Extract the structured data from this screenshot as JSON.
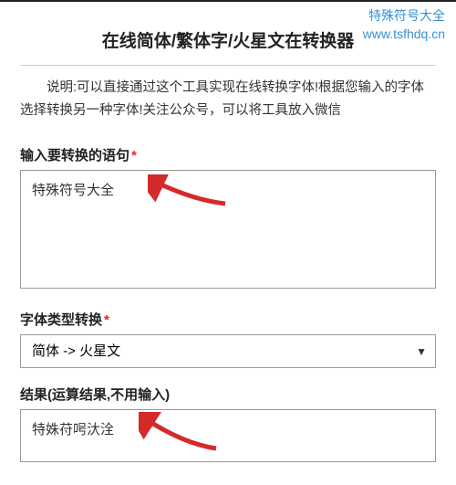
{
  "watermark": {
    "line1": "特殊符号大全",
    "line2": "www.tsfhdq.cn"
  },
  "title": "在线简体/繁体字/火星文在转换器",
  "description": "说明:可以直接通过这个工具实现在线转换字体!根据您输入的字体选择转换另一种字体!关注公众号，可以将工具放入微信",
  "fields": {
    "input": {
      "label": "输入要转换的语句",
      "required": "*",
      "value": "特殊符号大全"
    },
    "type": {
      "label": "字体类型转换",
      "required": "*",
      "selected": "简体 -> 火星文"
    },
    "result": {
      "label": "结果(运算结果,不用输入)",
      "value": "特姝苻呺汏洤"
    }
  }
}
